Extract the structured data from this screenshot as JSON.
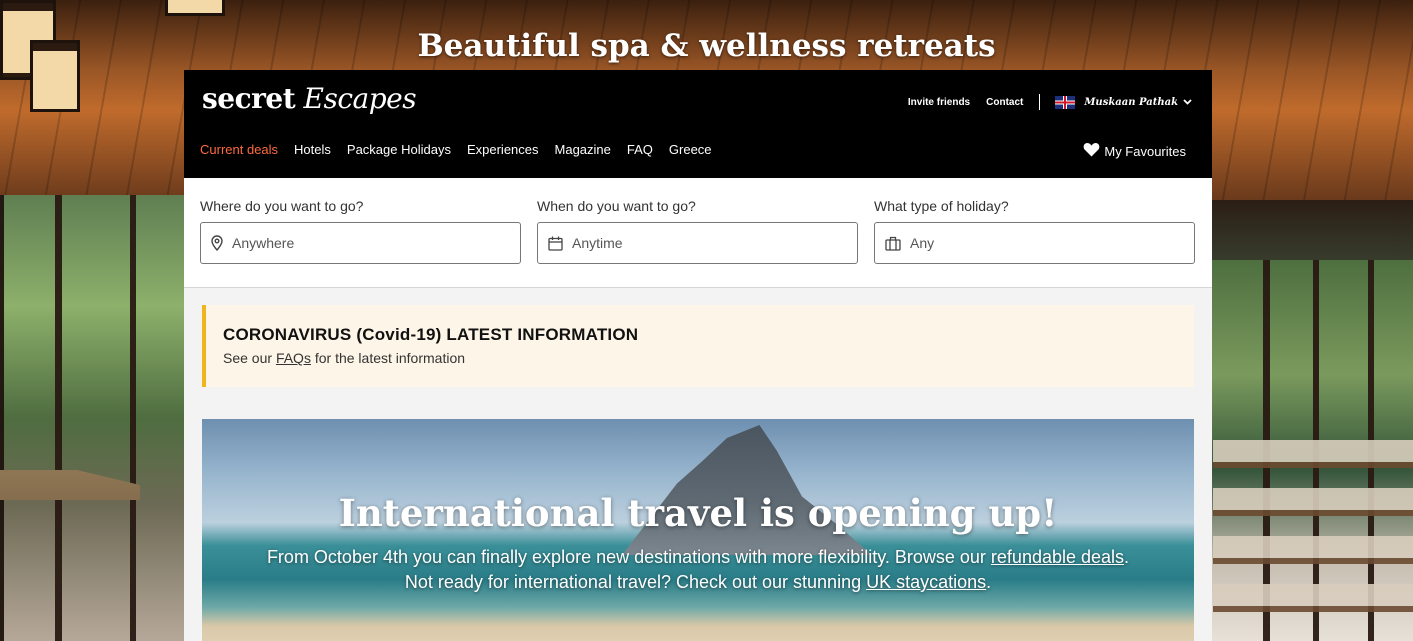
{
  "headline": "Beautiful spa & wellness retreats",
  "header": {
    "logo_bold": "secret",
    "logo_italic": "Escapes",
    "invite_label": "Invite friends",
    "contact_label": "Contact",
    "user_name": "Muskaan Pathak",
    "favourites_label": "My Favourites"
  },
  "nav": {
    "items": [
      {
        "label": "Current deals"
      },
      {
        "label": "Hotels"
      },
      {
        "label": "Package Holidays"
      },
      {
        "label": "Experiences"
      },
      {
        "label": "Magazine"
      },
      {
        "label": "FAQ"
      },
      {
        "label": "Greece"
      }
    ]
  },
  "search": {
    "where_label": "Where do you want to go?",
    "where_value": "Anywhere",
    "when_label": "When do you want to go?",
    "when_value": "Anytime",
    "type_label": "What type of holiday?",
    "type_value": "Any"
  },
  "notice": {
    "title": "CORONAVIRUS (Covid-19) LATEST INFORMATION",
    "text_before": "See our ",
    "link": "FAQs",
    "text_after": " for the latest information"
  },
  "hero": {
    "title": "International travel is opening up!",
    "text_1": "From October 4th you can finally explore new destinations with more flexibility. Browse our ",
    "link_1": "refundable deals",
    "text_2": ". Not ready for international travel? Check out our stunning ",
    "link_2": "UK staycations",
    "text_3": "."
  },
  "colors": {
    "active_nav": "#ff6a3d",
    "notice_accent": "#f0b41c",
    "notice_bg": "#fdf5e7"
  }
}
